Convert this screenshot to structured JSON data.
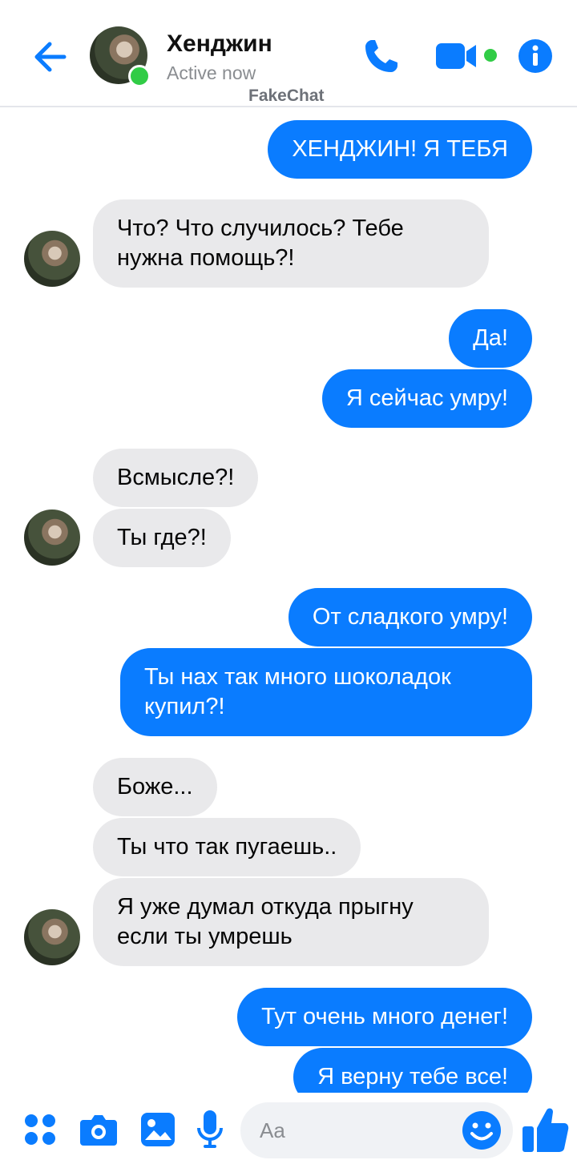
{
  "header": {
    "name": "Хенджин",
    "status": "Active now",
    "watermark": "FakeChat"
  },
  "messages": [
    {
      "side": "out",
      "text": "ХЕНДЖИН! Я ТЕБЯ"
    },
    {
      "side": "in",
      "lines": [
        "Что? Что случилось? Тебе",
        "нужна помощь?!"
      ]
    },
    {
      "side": "out",
      "text": "Да!"
    },
    {
      "side": "out",
      "text": "Я сейчас умру!"
    },
    {
      "side": "in",
      "text": "Всмысле?!"
    },
    {
      "side": "in",
      "text": "Ты где?!"
    },
    {
      "side": "out",
      "text": "От сладкого умру!"
    },
    {
      "side": "out",
      "lines": [
        "Ты нах так много шоколадок",
        "купил?!"
      ]
    },
    {
      "side": "in",
      "text": "Боже..."
    },
    {
      "side": "in",
      "text": "Ты что так пугаешь.."
    },
    {
      "side": "in",
      "lines": [
        "Я уже думал откуда прыгну",
        "если ты умрешь"
      ]
    },
    {
      "side": "out",
      "text": "Тут очень много денег!"
    },
    {
      "side": "out",
      "text": "Я верну тебе все!"
    }
  ],
  "composer": {
    "placeholder": "Aa"
  },
  "colors": {
    "accent": "#0a7cff",
    "incoming_bubble": "#e9e9eb",
    "online": "#31cc46"
  },
  "icons": [
    "back-arrow-icon",
    "phone-icon",
    "video-camera-icon",
    "info-icon",
    "menu-dots-icon",
    "camera-icon",
    "gallery-icon",
    "microphone-icon",
    "emoji-icon",
    "thumbs-up-icon"
  ]
}
